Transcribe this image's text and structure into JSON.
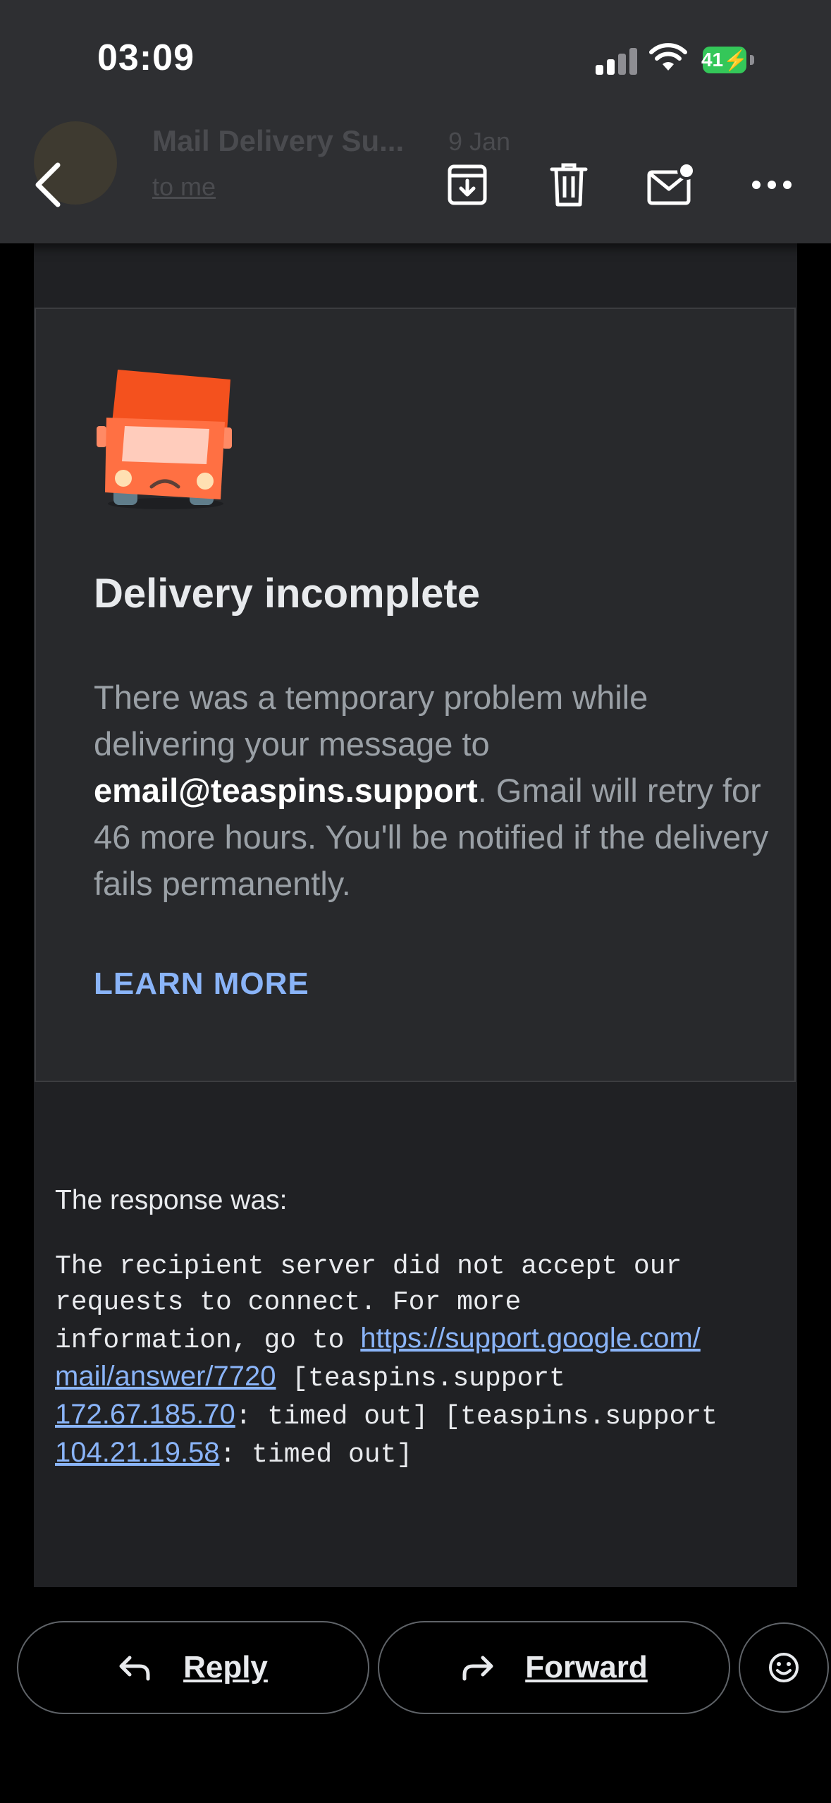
{
  "status_bar": {
    "time": "03:09",
    "battery": "41"
  },
  "header_ghost": {
    "sender": "Mail Delivery Su...",
    "date": "9 Jan",
    "to_me": "to me"
  },
  "card": {
    "title": "Delivery incomplete",
    "body_pre": "There was a temporary problem while delivering your message to ",
    "email": "email@teaspins.support",
    "body_post": ". Gmail will retry for 46 more hours. You'll be notified if the delivery fails permanently.",
    "learn_more": "LEARN MORE"
  },
  "response": {
    "label": "The response was:",
    "line1": "The recipient server did not accept our",
    "line2": "requests to connect. For more",
    "line3_pre": "information, go to ",
    "link1a": "https://support.google.com/",
    "link1b": "mail/answer/7720",
    "line4_post": " [teaspins.support",
    "ip1": "172.67.185.70",
    "line5_post": ": timed out] [teaspins.support",
    "ip2": "104.21.19.58",
    "line6_post": ": timed out]"
  },
  "actions": {
    "reply": "Reply",
    "forward": "Forward"
  },
  "colors": {
    "accent": "#8ab4f8",
    "truck": "#ff5722"
  }
}
